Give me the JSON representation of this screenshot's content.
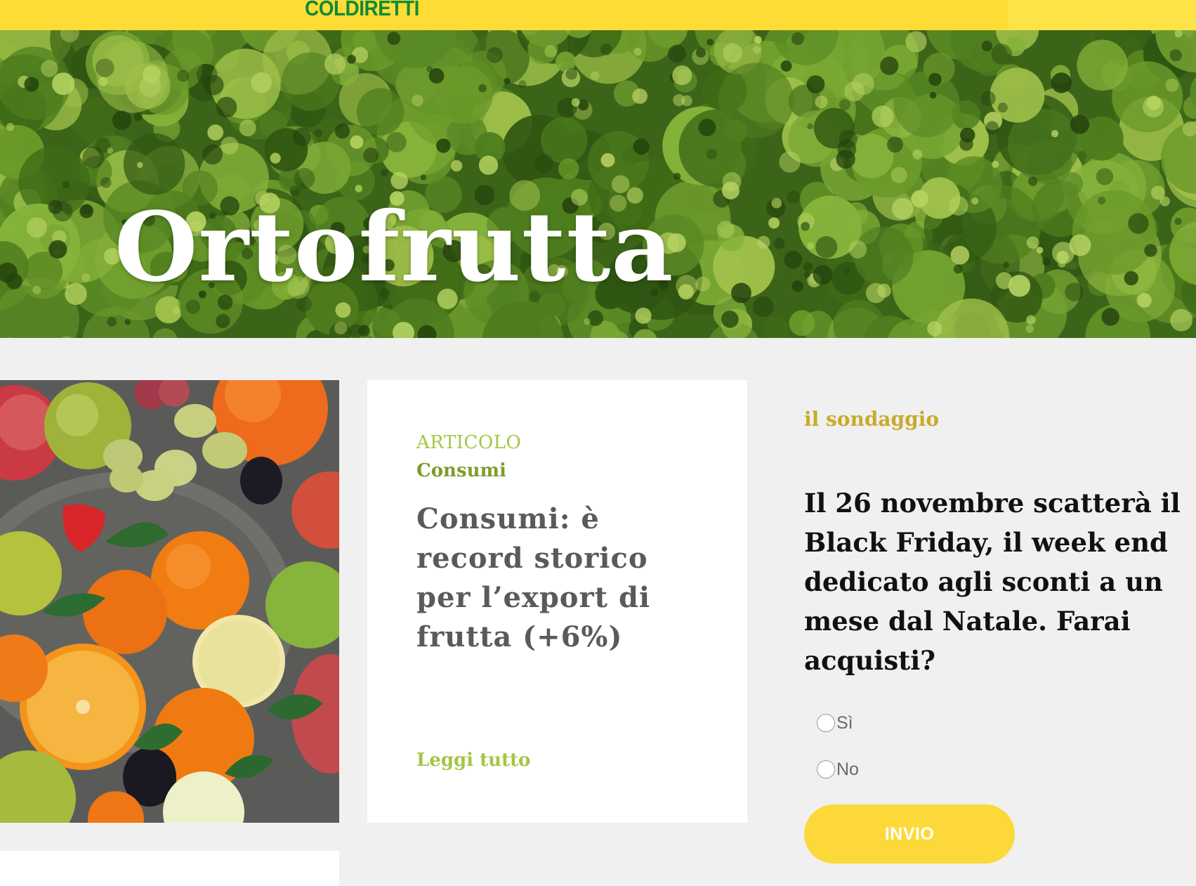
{
  "header": {
    "logo_text": "COLDIRETTI",
    "bar_color": "#fddc35",
    "logo_color": "#0f8a3a"
  },
  "hero": {
    "title": "Ortofrutta",
    "background": "aerial-forest-photo"
  },
  "article": {
    "image": "fruit-assortment-photo",
    "type_label": "ARTICOLO",
    "category": "Consumi",
    "title": "Consumi: è record storico per l’export di frutta (+6%)",
    "read_more": "Leggi tutto"
  },
  "survey": {
    "label": "il sondaggio",
    "question": "Il 26 novembre scatterà il Black Friday, il week end dedicato agli sconti a un mese dal Natale. Farai acquisti?",
    "options": [
      {
        "label": "Sì",
        "selected": false
      },
      {
        "label": "No",
        "selected": false
      }
    ],
    "submit_label": "INVIO",
    "accent_color": "#fcd939"
  }
}
